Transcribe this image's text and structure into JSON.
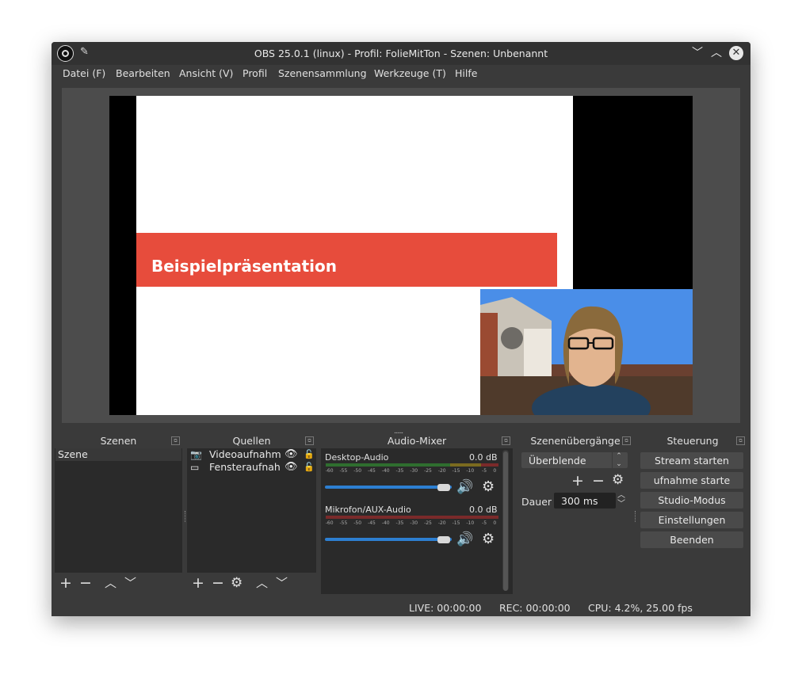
{
  "window": {
    "title": "OBS 25.0.1 (linux) - Profil: FolieMitTon - Szenen: Unbenannt"
  },
  "menu": [
    "Datei (F)",
    "Bearbeiten",
    "Ansicht (V)",
    "Profil",
    "Szenensammlung",
    "Werkzeuge (T)",
    "Hilfe"
  ],
  "preview": {
    "slide_title": "Beispielpräsentation"
  },
  "scenes": {
    "title": "Szenen",
    "items": [
      "Szene"
    ]
  },
  "sources": {
    "title": "Quellen",
    "items": [
      "Videoaufnahme",
      "Fensteraufnahme"
    ]
  },
  "mixer": {
    "title": "Audio-Mixer",
    "ticks": [
      "-60",
      "-55",
      "-50",
      "-45",
      "-40",
      "-35",
      "-30",
      "-25",
      "-20",
      "-15",
      "-10",
      "-5",
      "0"
    ],
    "channels": [
      {
        "name": "Desktop-Audio",
        "level": "0.0 dB",
        "volume": 0.85
      },
      {
        "name": "Mikrofon/AUX-Audio",
        "level": "0.0 dB",
        "volume": 0.85
      }
    ]
  },
  "transitions": {
    "title": "Szenenübergänge",
    "selected": "Überblende",
    "duration_label": "Dauer",
    "duration_value": "300 ms"
  },
  "controls": {
    "title": "Steuerung",
    "buttons": [
      "Stream starten",
      "ufnahme starte",
      "Studio-Modus",
      "Einstellungen",
      "Beenden"
    ]
  },
  "status": {
    "live": "LIVE: 00:00:00",
    "rec": "REC: 00:00:00",
    "cpu": "CPU: 4.2%, 25.00 fps"
  },
  "colors": {
    "accent_red": "#e74c3c",
    "slider_blue": "#2d7fd1",
    "dark_bg": "#2a2a2a"
  }
}
